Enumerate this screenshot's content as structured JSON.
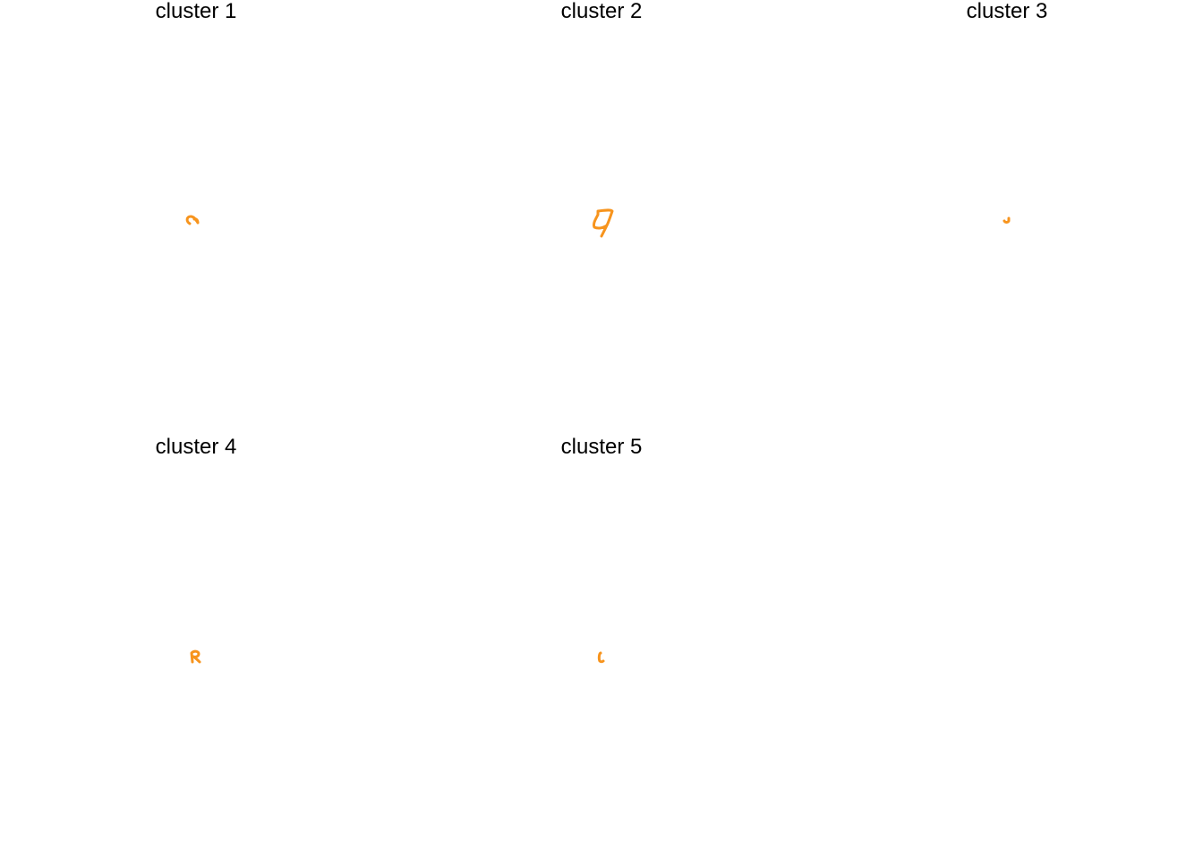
{
  "stroke_color": "#f7941d",
  "panels": [
    {
      "title": "cluster 1",
      "shape": "cluster-1-shape"
    },
    {
      "title": "cluster 2",
      "shape": "cluster-2-shape"
    },
    {
      "title": "cluster 3",
      "shape": "cluster-3-shape"
    },
    {
      "title": "cluster 4",
      "shape": "cluster-4-shape"
    },
    {
      "title": "cluster 5",
      "shape": "cluster-5-shape"
    }
  ]
}
